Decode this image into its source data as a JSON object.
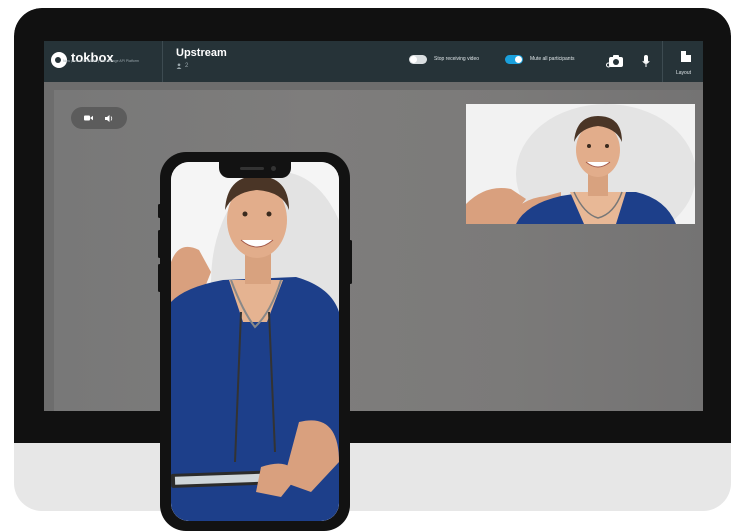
{
  "app": {
    "brand": "tokbox",
    "brand_tagline": "Now part of VONAGE | The Vonage API Platform",
    "session_title": "Upstream",
    "participant_count": "2"
  },
  "controls": {
    "stop_video_label": "Stop receiving video",
    "stop_video_on": false,
    "mute_all_label": "Mute all participants",
    "mute_all_on": true,
    "layout_label": "Layout"
  },
  "colors": {
    "topbar": "#263338",
    "toggle_on": "#1aa0dc",
    "toggle_off": "#d9dee0",
    "scrubs": "#1d3f8a"
  },
  "icons": [
    "tokbox-logo-icon",
    "person-icon",
    "camera-switch-icon",
    "microphone-icon",
    "layout-icon",
    "video-camera-icon",
    "speaker-icon"
  ]
}
